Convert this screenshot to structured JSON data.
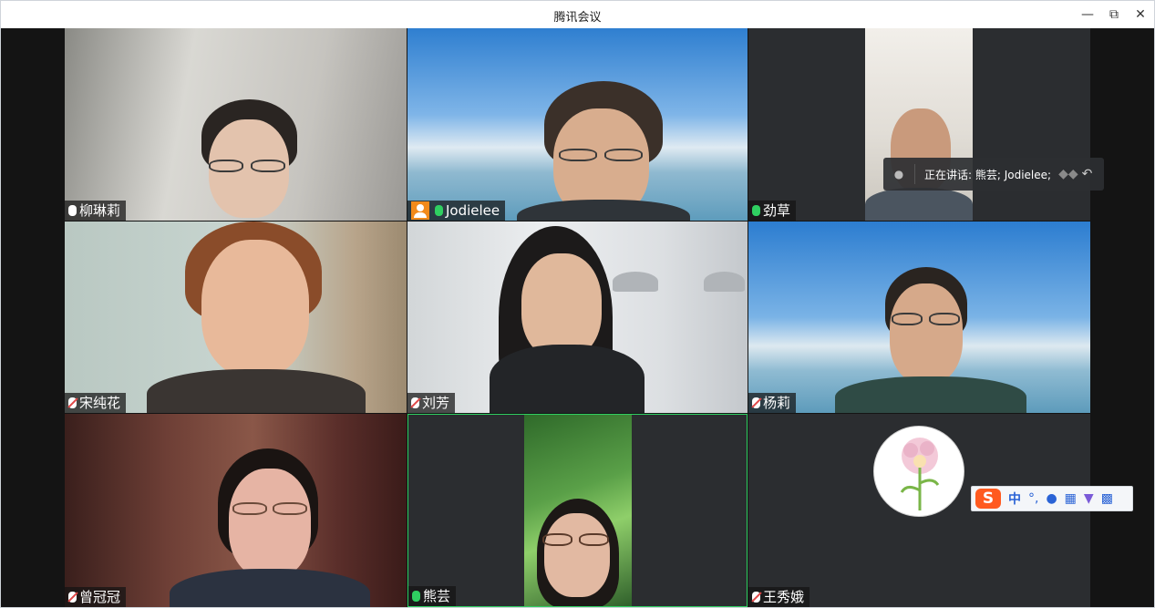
{
  "window": {
    "title": "腾讯会议"
  },
  "controls": {
    "minimize": "—",
    "restore": "⧉",
    "close": "✕"
  },
  "speaking": {
    "text": "正在讲话: 熊芸; Jodielee;"
  },
  "participants": [
    {
      "name": "柳琳莉",
      "mic": "active"
    },
    {
      "name": "Jodielee",
      "mic": "active",
      "host": true
    },
    {
      "name": "劲草",
      "mic": "active"
    },
    {
      "name": "宋纯花",
      "mic": "muted"
    },
    {
      "name": "刘芳",
      "mic": "muted"
    },
    {
      "name": "杨莉",
      "mic": "muted"
    },
    {
      "name": "曾冠冠",
      "mic": "muted"
    },
    {
      "name": "熊芸",
      "mic": "active"
    },
    {
      "name": "王秀娥",
      "mic": "muted"
    }
  ],
  "ime": {
    "logo": "S",
    "mode": "中",
    "punct": "°,",
    "icons": [
      "mic-icon",
      "keyboard-icon",
      "skin-icon",
      "apps-icon"
    ]
  },
  "colors": {
    "host_badge": "#f28a1a",
    "mic_active": "#2fcf61",
    "mic_muted": "#e04848",
    "ime_logo": "#ff5a1f"
  }
}
